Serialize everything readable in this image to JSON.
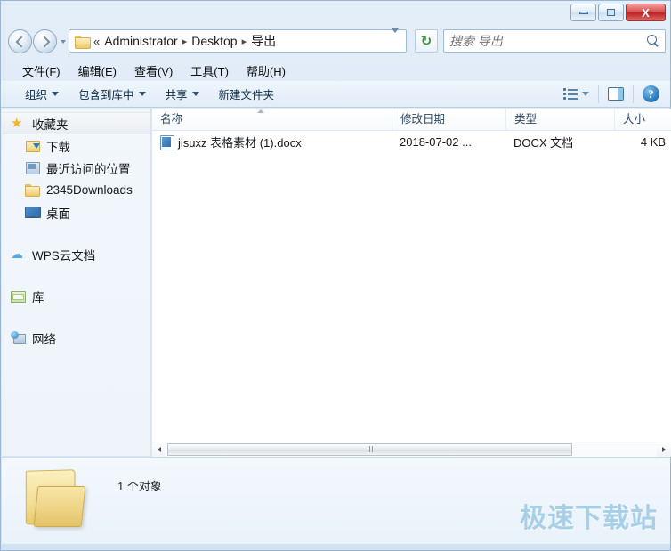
{
  "window": {
    "minimize_label": "–",
    "maximize_label": "□",
    "close_label": "X"
  },
  "address": {
    "back_tooltip": "后退",
    "forward_tooltip": "前进",
    "overflow": "«",
    "crumbs": [
      "Administrator",
      "Desktop",
      "导出"
    ],
    "separator": "▸",
    "refresh_label": "↻"
  },
  "search": {
    "placeholder": "搜索 导出",
    "value": ""
  },
  "menubar": {
    "items": [
      {
        "label": "文件(F)"
      },
      {
        "label": "编辑(E)"
      },
      {
        "label": "查看(V)"
      },
      {
        "label": "工具(T)"
      },
      {
        "label": "帮助(H)"
      }
    ]
  },
  "toolbar": {
    "buttons": [
      {
        "label": "组织",
        "has_caret": true
      },
      {
        "label": "包含到库中",
        "has_caret": true
      },
      {
        "label": "共享",
        "has_caret": true
      },
      {
        "label": "新建文件夹",
        "has_caret": false
      }
    ],
    "help_label": "?"
  },
  "sidebar": {
    "groups": [
      {
        "header": {
          "label": "收藏夹",
          "icon": "star-icon"
        },
        "items": [
          {
            "label": "下载",
            "icon": "downloads-icon"
          },
          {
            "label": "最近访问的位置",
            "icon": "recent-places-icon"
          },
          {
            "label": "2345Downloads",
            "icon": "folder-icon"
          },
          {
            "label": "桌面",
            "icon": "desktop-icon"
          }
        ]
      },
      {
        "header": {
          "label": "WPS云文档",
          "icon": "cloud-icon"
        },
        "items": []
      },
      {
        "header": {
          "label": "库",
          "icon": "library-icon"
        },
        "items": []
      },
      {
        "header": {
          "label": "网络",
          "icon": "network-icon"
        },
        "items": []
      }
    ]
  },
  "filelist": {
    "columns": [
      {
        "label": "名称",
        "sorted": true
      },
      {
        "label": "修改日期",
        "sorted": false
      },
      {
        "label": "类型",
        "sorted": false
      },
      {
        "label": "大小",
        "sorted": false
      }
    ],
    "rows": [
      {
        "icon": "docx-file-icon",
        "name": "jisuxz 表格素材 (1).docx",
        "date": "2018-07-02 ...",
        "type": "DOCX 文档",
        "size": "4 KB"
      }
    ]
  },
  "status": {
    "object_count": "1 个对象",
    "folder_icon": "large-folder-icon"
  },
  "watermark": {
    "text": "极速下载站",
    "color": "#a8cfe8"
  }
}
